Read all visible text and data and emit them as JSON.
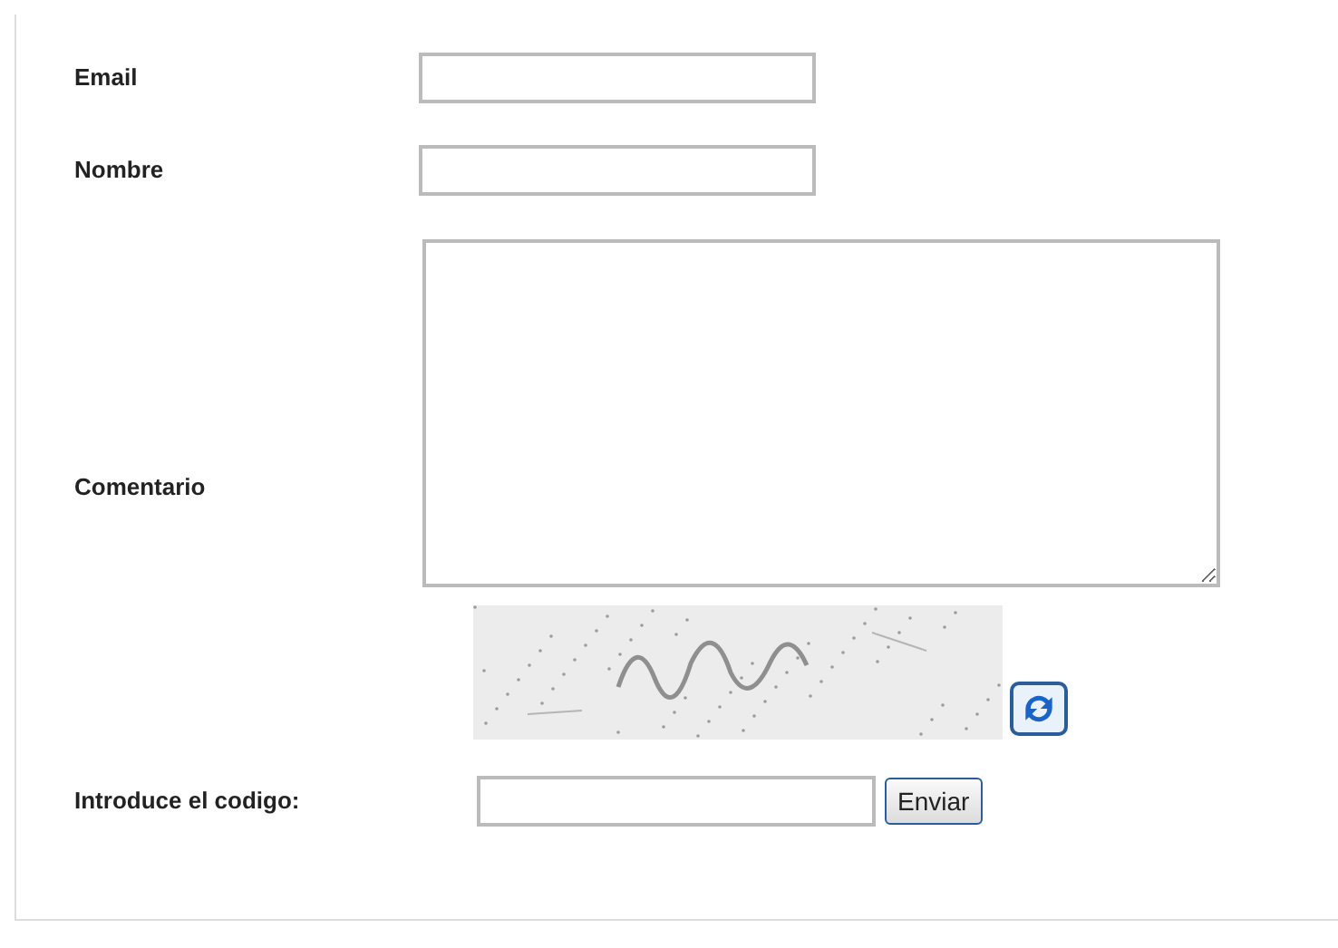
{
  "form": {
    "fields": [
      {
        "kind": "input",
        "label": "Email"
      },
      {
        "kind": "input",
        "label": "Nombre"
      },
      {
        "kind": "textarea",
        "label": "Comentario"
      }
    ],
    "code": {
      "label": "Introduce el codigo:",
      "button": "Enviar"
    }
  }
}
